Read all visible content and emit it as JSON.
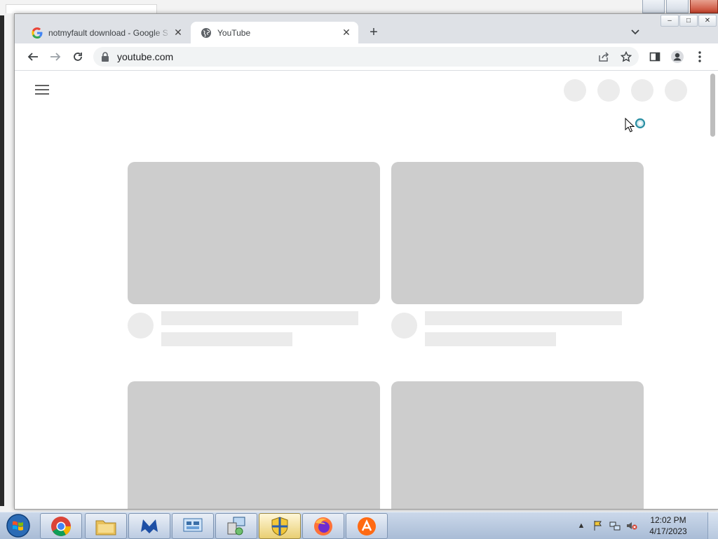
{
  "browser": {
    "tabs": [
      {
        "title": "notmyfault download - Google S",
        "favicon": "google-g-icon",
        "active": false
      },
      {
        "title": "YouTube",
        "favicon": "globe-icon",
        "active": true
      }
    ],
    "new_tab_label": "+",
    "address": {
      "url": "youtube.com"
    },
    "window_controls": {
      "minimize": "–",
      "maximize": "□",
      "close": "✕"
    }
  },
  "page": {
    "state": "loading-skeleton",
    "cards": 4
  },
  "taskbar": {
    "apps": [
      "chrome-icon",
      "file-explorer-icon",
      "malwarebytes-icon",
      "remote-desktop-icon",
      "network-setup-icon",
      "windows-security-icon",
      "firefox-icon",
      "avast-icon"
    ],
    "clock": {
      "time": "12:02 PM",
      "date": "4/17/2023"
    }
  },
  "colors": {
    "skeleton_dark": "#cdcdcd",
    "skeleton_light": "#ebebeb",
    "tab_strip": "#dee1e6",
    "omnibox": "#f1f3f4"
  }
}
